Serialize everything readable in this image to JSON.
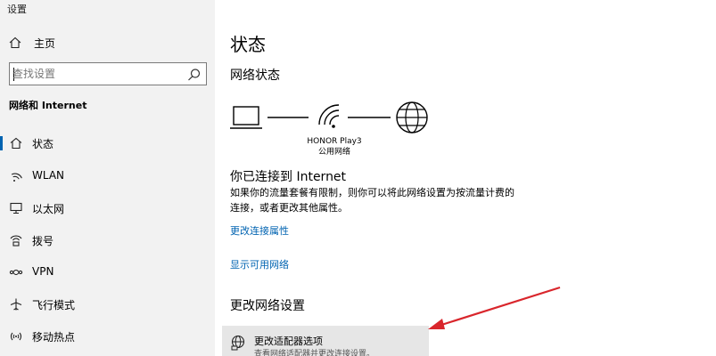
{
  "window": {
    "title": "设置"
  },
  "sidebar": {
    "home_label": "主页",
    "search_placeholder": "查找设置",
    "section_title": "网络和 Internet",
    "items": [
      {
        "label": "状态",
        "icon": "home-status-icon"
      },
      {
        "label": "WLAN",
        "icon": "wifi-icon"
      },
      {
        "label": "以太网",
        "icon": "ethernet-icon"
      },
      {
        "label": "拨号",
        "icon": "dialup-icon"
      },
      {
        "label": "VPN",
        "icon": "vpn-icon"
      },
      {
        "label": "飞行模式",
        "icon": "airplane-icon"
      },
      {
        "label": "移动热点",
        "icon": "hotspot-icon"
      }
    ]
  },
  "main": {
    "page_title": "状态",
    "network_status_title": "网络状态",
    "network_name": "HONOR Play3",
    "network_type": "公用网络",
    "connected_heading": "你已连接到 Internet",
    "connected_desc": "如果你的流量套餐有限制，则你可以将此网络设置为按流量计费的连接，或者更改其他属性。",
    "link_change_props": "更改连接属性",
    "link_show_networks": "显示可用网络",
    "change_settings_title": "更改网络设置",
    "adapter_title": "更改适配器选项",
    "adapter_desc": "查看网络适配器并更改连接设置。"
  },
  "colors": {
    "accent": "#0063b1",
    "annotation_arrow": "#d9262c"
  }
}
